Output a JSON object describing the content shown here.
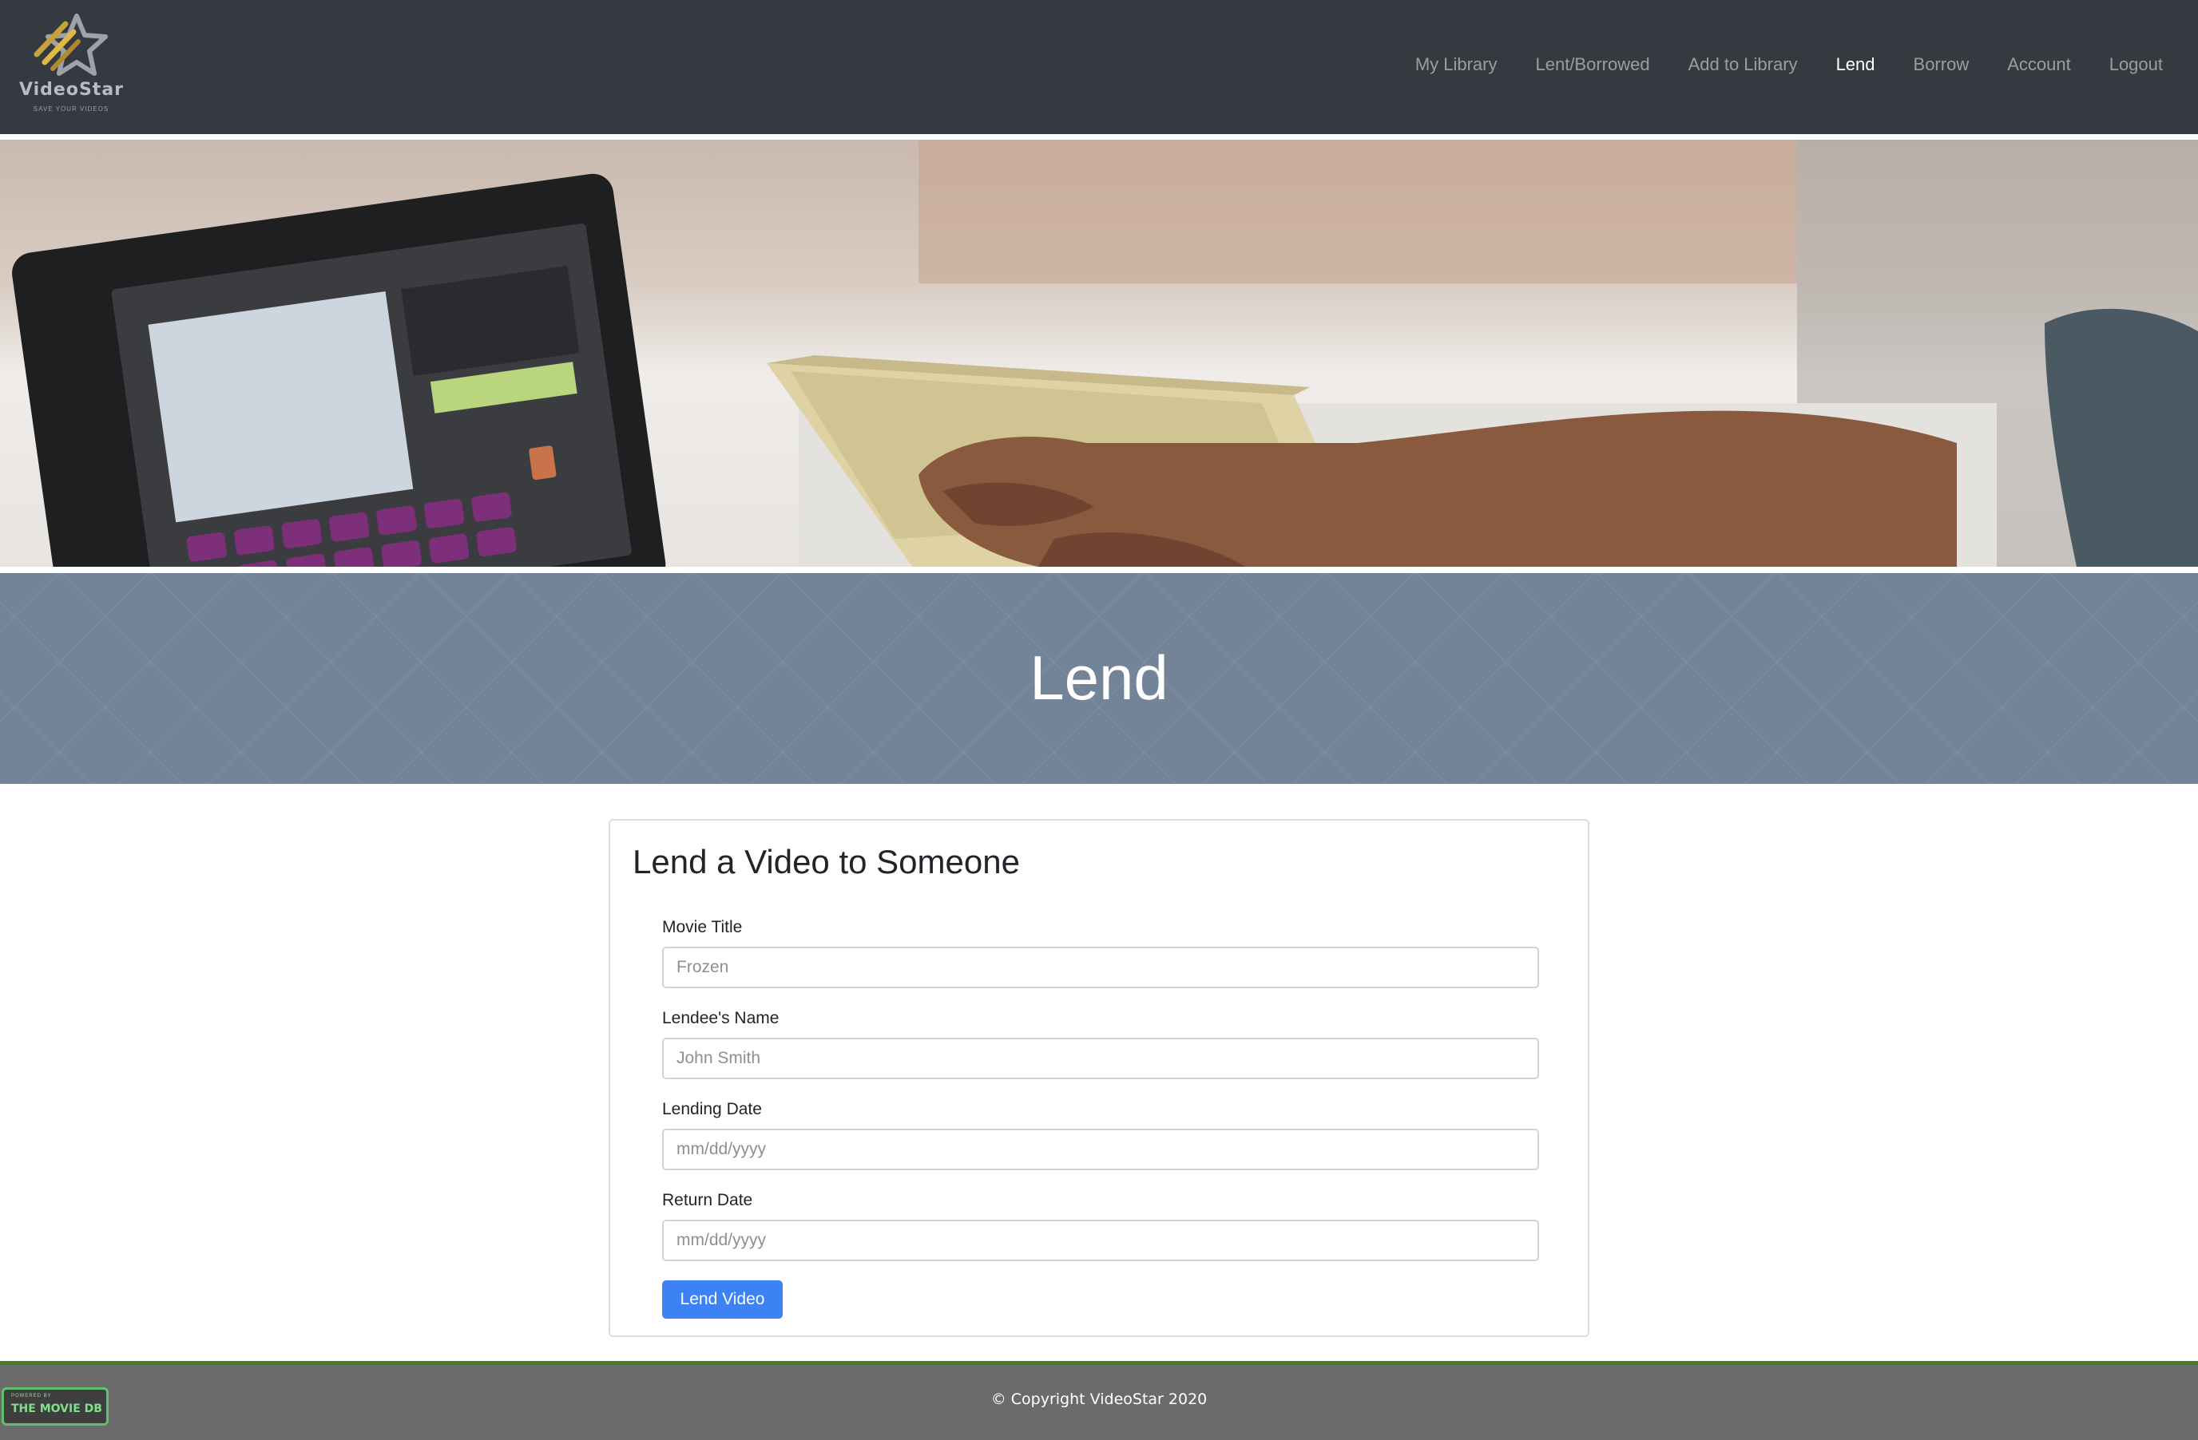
{
  "brand": {
    "name": "VideoStar",
    "tagline": "SAVE YOUR VIDEOS"
  },
  "nav": {
    "items": [
      {
        "label": "My Library",
        "active": false
      },
      {
        "label": "Lent/Borrowed",
        "active": false
      },
      {
        "label": "Add to Library",
        "active": false
      },
      {
        "label": "Lend",
        "active": true
      },
      {
        "label": "Borrow",
        "active": false
      },
      {
        "label": "Account",
        "active": false
      },
      {
        "label": "Logout",
        "active": false
      }
    ]
  },
  "banner": {
    "title": "Lend"
  },
  "form": {
    "title": "Lend a Video to Someone",
    "fields": [
      {
        "label": "Movie Title",
        "placeholder": "Frozen",
        "value": ""
      },
      {
        "label": "Lendee's Name",
        "placeholder": "John Smith",
        "value": ""
      },
      {
        "label": "Lending Date",
        "placeholder": "mm/dd/yyyy",
        "value": ""
      },
      {
        "label": "Return Date",
        "placeholder": "mm/dd/yyyy",
        "value": ""
      }
    ],
    "submit_label": "Lend Video"
  },
  "footer": {
    "copyright": "© Copyright VideoStar 2020",
    "badge_small": "POWERED BY",
    "badge_big": "THE MOVIE DB"
  },
  "colors": {
    "navbar_bg": "#343a40",
    "banner_bg": "#738499",
    "primary_button": "#3c82f4",
    "footer_bg": "#6b6b6b",
    "footer_accent": "#4a7a2a",
    "tmdb_green": "#5fc26a"
  },
  "icons": {
    "logo": "star-logo-icon",
    "badge": "tmdb-badge-icon"
  }
}
